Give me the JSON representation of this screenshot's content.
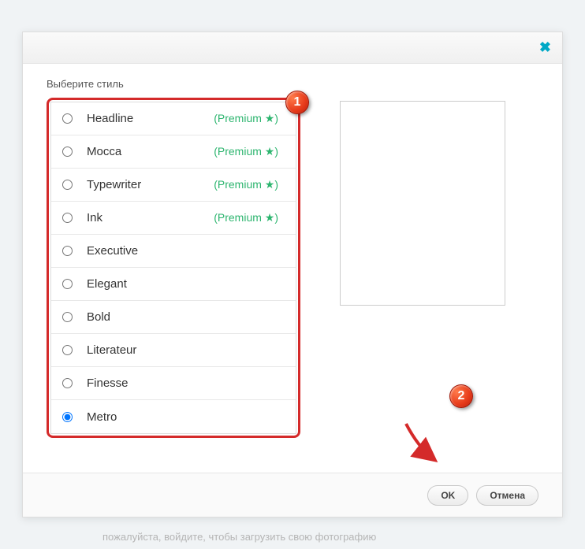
{
  "dialog": {
    "title": "Выберите стиль",
    "close": "✖"
  },
  "styles": [
    {
      "name": "Headline",
      "premium": true,
      "selected": false
    },
    {
      "name": "Mocca",
      "premium": true,
      "selected": false
    },
    {
      "name": "Typewriter",
      "premium": true,
      "selected": false
    },
    {
      "name": "Ink",
      "premium": true,
      "selected": false
    },
    {
      "name": "Executive",
      "premium": false,
      "selected": false
    },
    {
      "name": "Elegant",
      "premium": false,
      "selected": false
    },
    {
      "name": "Bold",
      "premium": false,
      "selected": false
    },
    {
      "name": "Literateur",
      "premium": false,
      "selected": false
    },
    {
      "name": "Finesse",
      "premium": false,
      "selected": false
    },
    {
      "name": "Metro",
      "premium": false,
      "selected": true
    }
  ],
  "premium_label": "(Premium ★)",
  "buttons": {
    "ok": "OK",
    "cancel": "Отмена"
  },
  "annotations": {
    "badge1": "1",
    "badge2": "2"
  },
  "background_hint": "пожалуйста, войдите, чтобы загрузить свою фотографию"
}
